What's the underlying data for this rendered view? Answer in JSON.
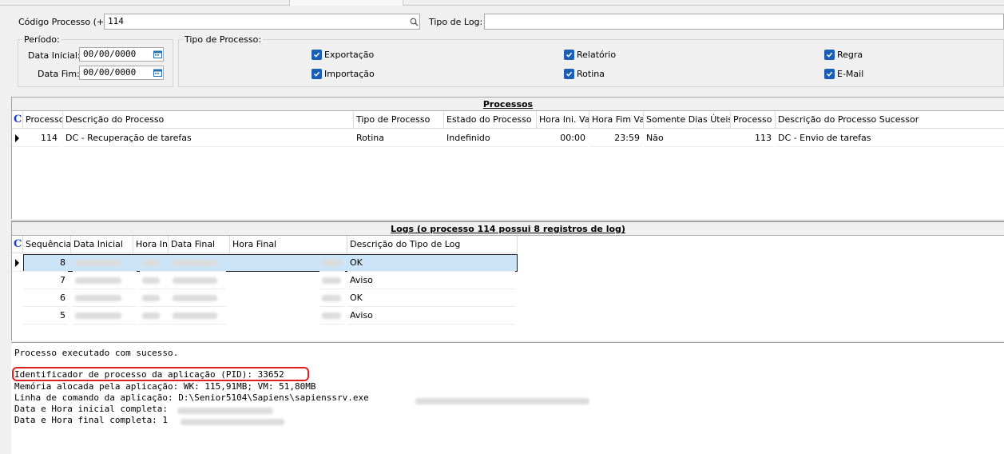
{
  "filters": {
    "codigo_label": "Código Processo (+):",
    "codigo_value": "114",
    "tipo_log_label": "Tipo de Log:",
    "tipo_log_value": "",
    "periodo_title": "Período:",
    "data_inicial_label": "Data Inicial:",
    "data_inicial_value": "00/00/0000",
    "data_fim_label": "Data Fim:",
    "data_fim_value": "00/00/0000",
    "tipo_processo_title": "Tipo de Processo:",
    "checks": [
      {
        "label": "Exportação",
        "checked": true
      },
      {
        "label": "Importação",
        "checked": true
      },
      {
        "label": "Relatório",
        "checked": true
      },
      {
        "label": "Rotina",
        "checked": true
      },
      {
        "label": "Regra",
        "checked": true
      },
      {
        "label": "E-Mail",
        "checked": true
      }
    ]
  },
  "processos": {
    "title": "Processos",
    "corner": "C",
    "columns": [
      "Processo",
      "Descrição do Processo",
      "Tipo de Processo",
      "Estado do Processo",
      "Hora Ini. Va",
      "Hora Fim Va",
      "Somente Dias Úteis",
      "Processo S",
      "Descrição do Processo Sucessor"
    ],
    "row": {
      "processo": "114",
      "descricao": "DC - Recuperação de tarefas",
      "tipo": "Rotina",
      "estado": "Indefinido",
      "hora_ini": "00:00",
      "hora_fim": "23:59",
      "somente_dias_uteis": "Não",
      "processo_sucessor": "113",
      "descricao_sucessor": "DC - Envio de tarefas"
    }
  },
  "logs": {
    "title": "Logs (o processo 114 possui 8 registros de log)",
    "corner": "C",
    "columns": [
      "Sequência",
      "Data Inicial",
      "Hora Ini",
      "Data Final",
      "Hora Final",
      "Descrição do Tipo de Log"
    ],
    "rows": [
      {
        "seq": "8",
        "tipo": "OK"
      },
      {
        "seq": "7",
        "tipo": "Aviso"
      },
      {
        "seq": "6",
        "tipo": "OK"
      },
      {
        "seq": "5",
        "tipo": "Aviso"
      }
    ]
  },
  "output": {
    "line1": "Processo executado com sucesso.",
    "line2": "Identificador de processo da aplicação (PID): 33652",
    "line3": "Memória alocada pela aplicação: WK: 115,91MB; VM: 51,80MB",
    "line4": "Linha de comando da aplicação: D:\\Senior5104\\Sapiens\\sapienssrv.exe",
    "line5": "Data e Hora inicial completa:",
    "line6": "Data e Hora final completa: 1"
  },
  "colors": {
    "checkbox": "#1a5fb4",
    "selected_row": "#cce4f7",
    "highlight_border": "#e02020",
    "corner_letter": "#1a3cc8"
  }
}
